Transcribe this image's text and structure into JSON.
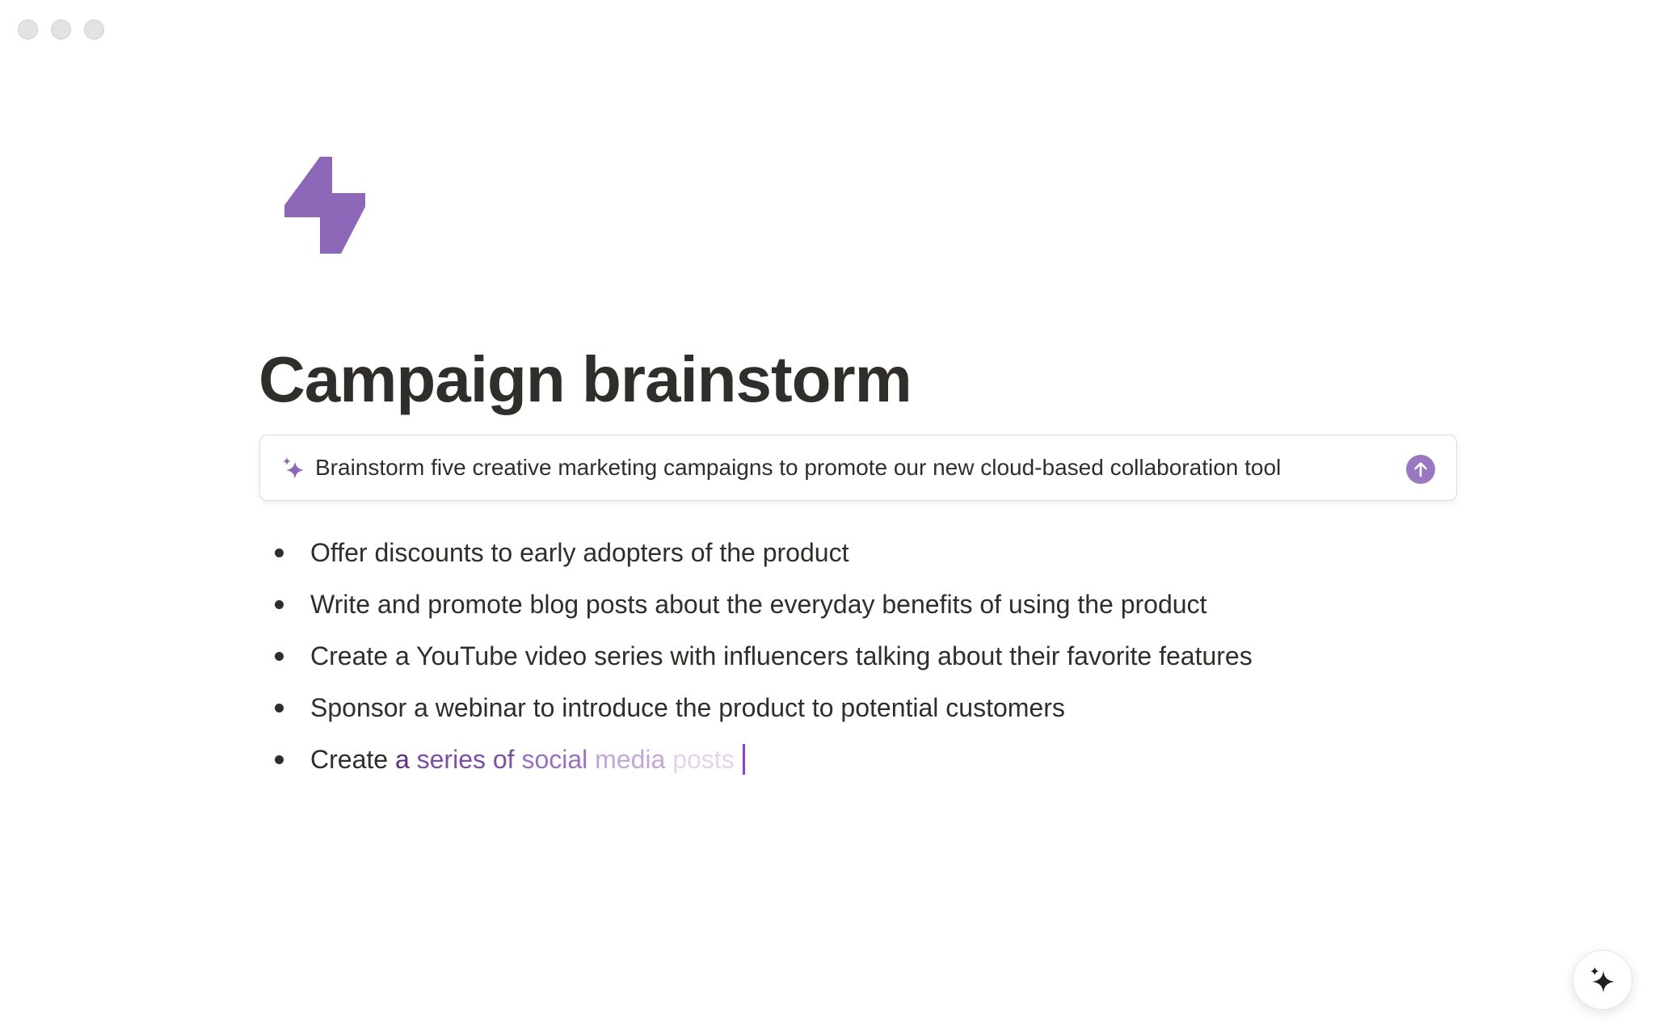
{
  "window": {
    "controls": [
      "close",
      "minimize",
      "zoom"
    ]
  },
  "page": {
    "icon": "lightning-bolt-icon",
    "title": "Campaign brainstorm"
  },
  "ai_prompt": {
    "icon": "sparkle-icon",
    "text": "Brainstorm five creative marketing campaigns to promote our new cloud-based collaboration tool",
    "submit_icon": "arrow-up-icon"
  },
  "bullets": [
    "Offer discounts to early adopters of the product",
    "Write and promote blog posts about the everyday benefits of using the product",
    "Create a YouTube video series with influencers talking about their favorite features",
    "Sponsor a webinar to introduce the product to potential customers"
  ],
  "streaming_bullet": {
    "text": "Create a series of social media posts",
    "segments": [
      "Create",
      " a",
      " series of",
      " social",
      " media",
      " posts"
    ]
  },
  "ai_button": {
    "icon": "sparkle-icon"
  },
  "colors": {
    "accent_purple": "#8e68b8",
    "submit_button": "#9a77c1",
    "cursor": "#8b3fd6",
    "title_text": "#2f2e2b"
  }
}
